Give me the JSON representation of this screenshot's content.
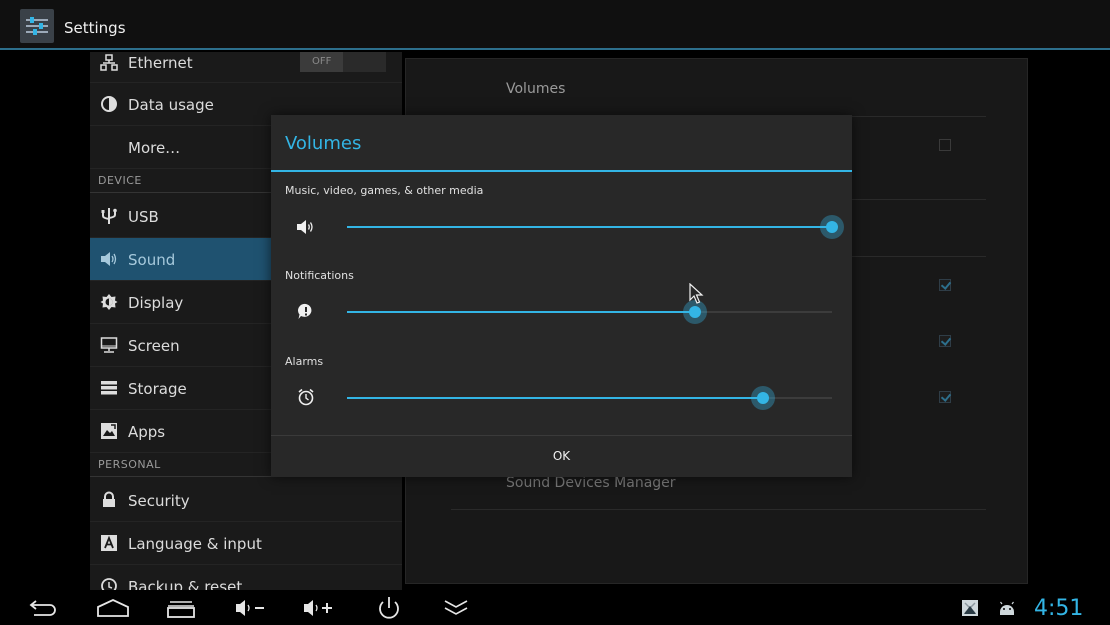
{
  "app": {
    "title": "Settings",
    "icon": "settings-sliders-icon"
  },
  "left_panel": {
    "items": [
      {
        "id": "ethernet",
        "label": "Ethernet",
        "icon": "ethernet-icon",
        "toggle": "OFF"
      },
      {
        "id": "data-usage",
        "label": "Data usage",
        "icon": "data-usage-icon"
      },
      {
        "id": "more",
        "label": "More…",
        "icon": ""
      }
    ],
    "sections": [
      {
        "header": "DEVICE",
        "items": [
          {
            "id": "usb",
            "label": "USB",
            "icon": "usb-icon"
          },
          {
            "id": "sound",
            "label": "Sound",
            "icon": "speaker-icon",
            "selected": true
          },
          {
            "id": "display",
            "label": "Display",
            "icon": "display-brightness-icon"
          },
          {
            "id": "screen",
            "label": "Screen",
            "icon": "monitor-icon"
          },
          {
            "id": "storage",
            "label": "Storage",
            "icon": "storage-icon"
          },
          {
            "id": "apps",
            "label": "Apps",
            "icon": "apps-icon"
          }
        ]
      },
      {
        "header": "PERSONAL",
        "items": [
          {
            "id": "security",
            "label": "Security",
            "icon": "lock-icon"
          },
          {
            "id": "language",
            "label": "Language & input",
            "icon": "keyboard-a-icon"
          },
          {
            "id": "backup",
            "label": "Backup & reset",
            "icon": "backup-icon"
          }
        ]
      }
    ]
  },
  "right_panel": {
    "title": "Volumes",
    "footer_item": "Sound Devices Manager",
    "checkboxes": [
      false,
      true,
      true,
      true
    ]
  },
  "dialog": {
    "title": "Volumes",
    "sliders": [
      {
        "id": "media",
        "label": "Music, video, games, & other media",
        "icon": "speaker-icon",
        "level": 1.0
      },
      {
        "id": "notifications",
        "label": "Notifications",
        "icon": "notification-bubble-icon",
        "level": 0.717
      },
      {
        "id": "alarms",
        "label": "Alarms",
        "icon": "alarm-clock-icon",
        "level": 0.857
      }
    ],
    "ok_label": "OK"
  },
  "navbar": {
    "buttons": [
      "back-icon",
      "home-icon",
      "recent-apps-icon",
      "volume-down-icon",
      "volume-up-icon",
      "power-icon",
      "hide-bar-icon"
    ],
    "status_icons": [
      "screenshot-icon",
      "android-debug-icon"
    ],
    "time": "4:51"
  },
  "colors": {
    "accent": "#33b5e5",
    "selected_bg": "#1f5270"
  }
}
